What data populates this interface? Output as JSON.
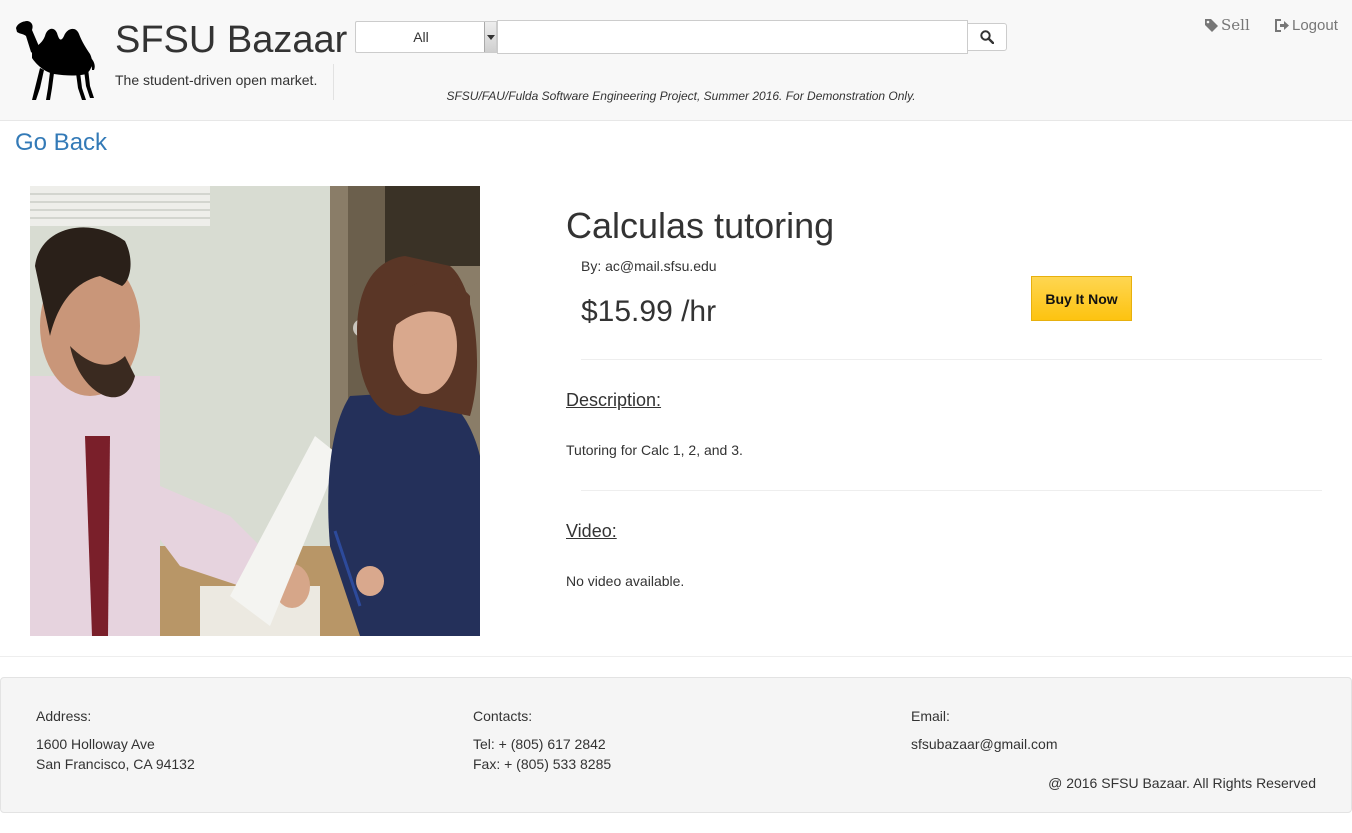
{
  "header": {
    "brand_title": "SFSU Bazaar",
    "tagline": "The student-driven open market.",
    "category_selected": "All",
    "search_value": "",
    "disclaimer": "SFSU/FAU/Fulda Software Engineering Project, Summer 2016. For Demonstration Only.",
    "nav": {
      "sell_label": "Sell",
      "logout_label": "Logout"
    }
  },
  "main": {
    "go_back_label": "Go Back",
    "product": {
      "title": "Calculas tutoring",
      "seller": "By: ac@mail.sfsu.edu",
      "price": "$15.99 /hr",
      "buy_label": "Buy It Now",
      "description_heading": "Description:",
      "description_text": "Tutoring for Calc 1, 2, and 3.",
      "video_heading": "Video:",
      "video_text": "No video available."
    }
  },
  "footer": {
    "address_label": "Address:",
    "address_line1": "1600 Holloway Ave",
    "address_line2": "San Francisco, CA 94132",
    "contacts_label": "Contacts:",
    "tel": "Tel: + (805) 617 2842",
    "fax": "Fax: + (805) 533 8285",
    "email_label": "Email:",
    "email": "sfsubazaar@gmail.com",
    "copyright": "@ 2016 SFSU Bazaar. All Rights Reserved"
  },
  "colors": {
    "link": "#337ab7",
    "buy_button": "#fdc310",
    "header_bg": "#f8f8f8",
    "footer_bg": "#f5f5f5"
  },
  "icons": [
    "camel-logo-icon",
    "chevron-down-icon",
    "search-icon",
    "tag-icon",
    "logout-icon"
  ]
}
